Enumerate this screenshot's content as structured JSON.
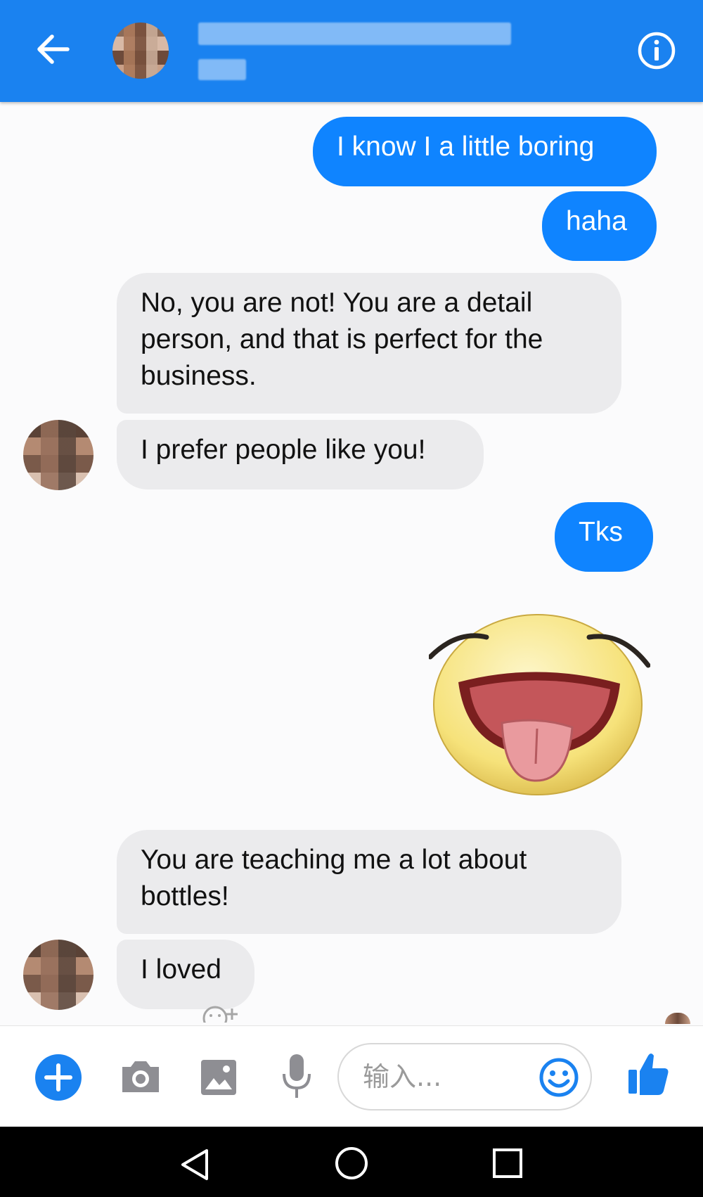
{
  "header": {
    "contact_name": "████ ████████",
    "contact_status": "██"
  },
  "messages": [
    {
      "id": "m1",
      "from": "me",
      "text": "I know I a little boring"
    },
    {
      "id": "m2",
      "from": "me",
      "text": "haha"
    },
    {
      "id": "m3",
      "from": "them",
      "text": "No, you are not! You are a detail person, and that is perfect for the business."
    },
    {
      "id": "m4",
      "from": "them",
      "text": "I prefer people like you!"
    },
    {
      "id": "m5",
      "from": "me",
      "text": "Tks"
    },
    {
      "id": "m6",
      "from": "me",
      "sticker": "laughing-tongue-out-face"
    },
    {
      "id": "m7",
      "from": "them",
      "text": "You are teaching me a lot about bottles!"
    },
    {
      "id": "m8",
      "from": "them",
      "text": "I loved"
    }
  ],
  "composer": {
    "placeholder": "输入..."
  },
  "colors": {
    "header_bg": "#1a82f0",
    "outgoing_bubble": "#0f84ff",
    "incoming_bubble": "#ebebed",
    "icon_gray": "#8e8e93",
    "accent": "#1a82f0"
  },
  "icons": {
    "back": "arrow-left-icon",
    "info": "info-icon",
    "add": "plus-circle-icon",
    "camera": "camera-icon",
    "gallery": "image-icon",
    "mic": "microphone-icon",
    "emoji": "smiley-icon",
    "like": "thumbs-up-icon",
    "reaction": "add-reaction-icon"
  }
}
